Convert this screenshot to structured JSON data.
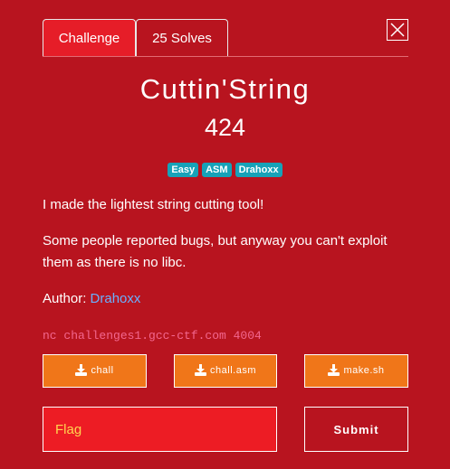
{
  "tabs": [
    {
      "label": "Challenge",
      "active": true
    },
    {
      "label": "25 Solves",
      "active": false
    }
  ],
  "challenge": {
    "name": "Cuttin'String",
    "points": "424",
    "tags": [
      "Easy",
      "ASM",
      "Drahoxx"
    ],
    "description": [
      "I made the lightest string cutting tool!",
      "Some people reported bugs, but anyway you can't exploit them as there is no libc."
    ],
    "author_label": "Author:",
    "author_name": "Drahoxx",
    "connection": "nc challenges1.gcc-ctf.com 4004"
  },
  "files": [
    {
      "name": "chall",
      "icon": "download-icon"
    },
    {
      "name": "chall.asm",
      "icon": "download-icon"
    },
    {
      "name": "make.sh",
      "icon": "download-icon"
    }
  ],
  "form": {
    "flag_placeholder": "Flag",
    "flag_value": "",
    "submit_label": "Submit"
  },
  "colors": {
    "background": "#b8141f",
    "active_tab": "#e61d28",
    "tag": "#17a2b8",
    "download_button": "#f07619",
    "author_link": "#6ab0ff",
    "connection_text": "#f3678f",
    "flag_input": "#ed1c24",
    "flag_placeholder": "#ffd54f"
  }
}
